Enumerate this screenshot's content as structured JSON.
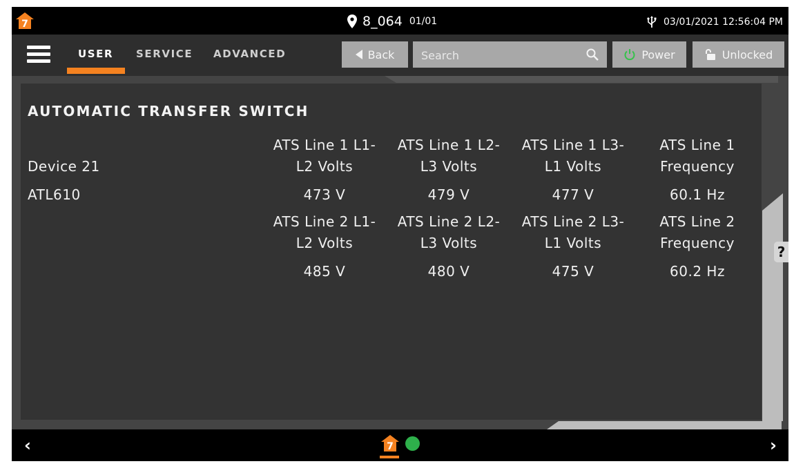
{
  "status_bar": {
    "location": "8_064",
    "page_indicator": "01/01",
    "datetime": "03/01/2021 12:56:04 PM",
    "icons": [
      "app-logo-icon",
      "location-pin-icon",
      "usb-icon"
    ]
  },
  "nav": {
    "tabs": [
      {
        "label": "USER",
        "active": true
      },
      {
        "label": "SERVICE",
        "active": false
      },
      {
        "label": "ADVANCED",
        "active": false
      }
    ],
    "back_label": "Back",
    "search_placeholder": "Search",
    "power_label": "Power",
    "lock_label": "Unlocked"
  },
  "panel": {
    "title": "AUTOMATIC TRANSFER SWITCH",
    "device_name": "Device 21",
    "device_model": "ATL610",
    "line1": {
      "headers": [
        [
          "ATS Line 1 L1-",
          "L2 Volts"
        ],
        [
          "ATS Line 1 L2-",
          "L3 Volts"
        ],
        [
          "ATS Line 1 L3-",
          "L1 Volts"
        ],
        [
          "ATS Line 1",
          "Frequency"
        ]
      ],
      "values": [
        "473 V",
        "479 V",
        "477 V",
        "60.1 Hz"
      ]
    },
    "line2": {
      "headers": [
        [
          "ATS Line 2 L1-",
          "L2 Volts"
        ],
        [
          "ATS Line 2 L2-",
          "L3 Volts"
        ],
        [
          "ATS Line 2 L3-",
          "L1 Volts"
        ],
        [
          "ATS Line 2",
          "Frequency"
        ]
      ],
      "values": [
        "485 V",
        "480 V",
        "475 V",
        "60.2 Hz"
      ]
    }
  },
  "help_label": "?",
  "bottom_bar": {
    "prev": "‹",
    "next": "›",
    "status_dot_color": "#2eb04b"
  },
  "colors": {
    "accent": "#f58220",
    "button_gray": "#a8a8a8",
    "panel_bg": "#333333",
    "power_icon": "#35c24a"
  }
}
